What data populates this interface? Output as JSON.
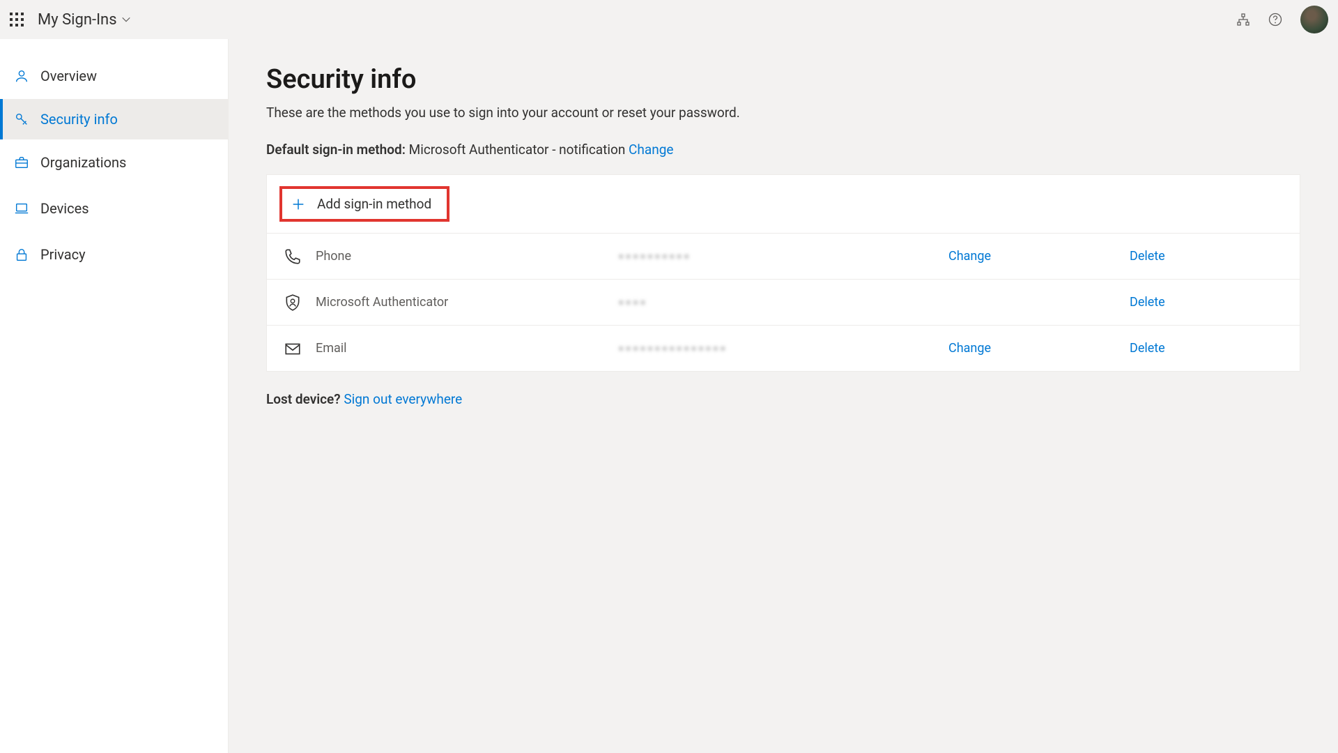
{
  "header": {
    "app_title": "My Sign-Ins"
  },
  "sidebar": {
    "items": [
      {
        "label": "Overview"
      },
      {
        "label": "Security info"
      },
      {
        "label": "Organizations"
      },
      {
        "label": "Devices"
      },
      {
        "label": "Privacy"
      }
    ]
  },
  "page": {
    "title": "Security info",
    "subtitle": "These are the methods you use to sign into your account or reset your password.",
    "default_label": "Default sign-in method:",
    "default_value": "Microsoft Authenticator - notification",
    "change": "Change",
    "add_method": "Add sign-in method",
    "lost_label": "Lost device?",
    "sign_out": "Sign out everywhere"
  },
  "methods": [
    {
      "name": "Phone",
      "value": "••••••••••",
      "change": "Change",
      "delete": "Delete"
    },
    {
      "name": "Microsoft Authenticator",
      "value": "••••",
      "change": "",
      "delete": "Delete"
    },
    {
      "name": "Email",
      "value": "•••••••••••••••",
      "change": "Change",
      "delete": "Delete"
    }
  ]
}
